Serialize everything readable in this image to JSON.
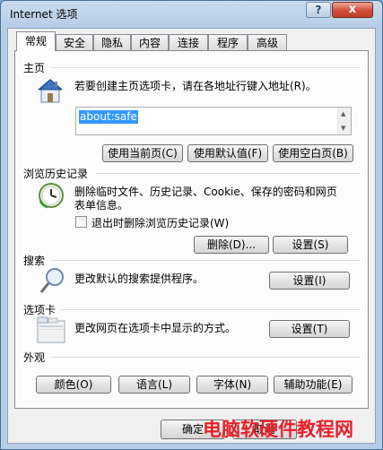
{
  "window": {
    "title": "Internet 选项",
    "help_label": "?",
    "close_label": "x"
  },
  "tabs": [
    {
      "label": "常规",
      "active": true
    },
    {
      "label": "安全",
      "active": false
    },
    {
      "label": "隐私",
      "active": false
    },
    {
      "label": "内容",
      "active": false
    },
    {
      "label": "连接",
      "active": false
    },
    {
      "label": "程序",
      "active": false
    },
    {
      "label": "高级",
      "active": false
    }
  ],
  "homepage": {
    "title": "主页",
    "description": "若要创建主页选项卡，请在各地址行键入地址(R)。",
    "address_value": "about:safe",
    "use_current_label": "使用当前页(C)",
    "use_default_label": "使用默认值(F)",
    "use_blank_label": "使用空白页(B)"
  },
  "history": {
    "title": "浏览历史记录",
    "description_line1": "删除临时文件、历史记录、Cookie、保存的密码和网页",
    "description_line2": "表单信息。",
    "checkbox_label": "退出时删除浏览历史记录(W)",
    "checkbox_checked": false,
    "delete_label": "删除(D)...",
    "settings_label": "设置(S)"
  },
  "search": {
    "title": "搜索",
    "description": "更改默认的搜索提供程序。",
    "settings_label": "设置(I)"
  },
  "tabs_section": {
    "title": "选项卡",
    "description": "更改网页在选项卡中显示的方式。",
    "settings_label": "设置(T)"
  },
  "appearance": {
    "title": "外观",
    "colors_label": "颜色(O)",
    "languages_label": "语言(L)",
    "fonts_label": "字体(N)",
    "accessibility_label": "辅助功能(E)"
  },
  "footer": {
    "ok_label": "确定",
    "cancel_label": "取消"
  },
  "watermark": "电脑软硬件教程网",
  "colors": {
    "selection": "#3399ff",
    "close_button": "#c94a34",
    "watermark": "#e8202a"
  }
}
